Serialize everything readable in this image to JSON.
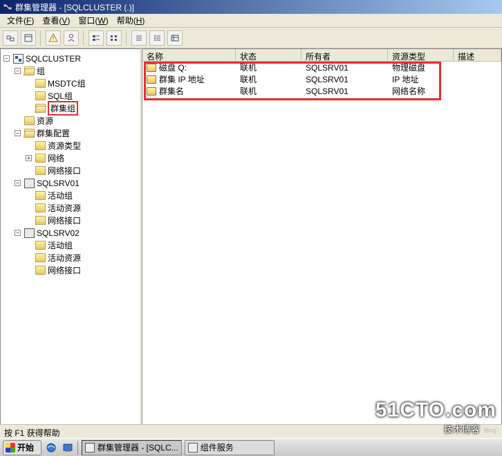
{
  "title": "群集管理器 - [SQLCLUSTER (.)]",
  "menu": {
    "file": "文件",
    "view": "查看",
    "window": "窗口",
    "help": "帮助",
    "file_acc": "F",
    "view_acc": "V",
    "window_acc": "W",
    "help_acc": "H"
  },
  "tree": {
    "root": "SQLCLUSTER",
    "groups": {
      "label": "组",
      "items": [
        "MSDTC组",
        "SQL组",
        "群集组"
      ]
    },
    "resources": "资源",
    "cluster_cfg": {
      "label": "群集配置",
      "items": [
        "资源类型",
        "网络",
        "网络接口"
      ]
    },
    "server1": {
      "label": "SQLSRV01",
      "items": [
        "活动组",
        "活动资源",
        "网络接口"
      ]
    },
    "server2": {
      "label": "SQLSRV02",
      "items": [
        "活动组",
        "活动资源",
        "网络接口"
      ]
    }
  },
  "columns": {
    "name": "名称",
    "status": "状态",
    "owner": "所有者",
    "type": "资源类型",
    "desc": "描述"
  },
  "rows": [
    {
      "name": "磁盘 Q:",
      "status": "联机",
      "owner": "SQLSRV01",
      "type": "物理磁盘"
    },
    {
      "name": "群集 IP 地址",
      "status": "联机",
      "owner": "SQLSRV01",
      "type": "IP 地址"
    },
    {
      "name": "群集名",
      "status": "联机",
      "owner": "SQLSRV01",
      "type": "网络名称"
    }
  ],
  "statusbar": "按 F1 获得帮助",
  "taskbar": {
    "start": "开始",
    "task1": "群集管理器 - [SQLC...",
    "task2": "组件服务"
  },
  "watermark": {
    "big": "51CTO.com",
    "small": "技术博客",
    "blog": "Blog"
  }
}
